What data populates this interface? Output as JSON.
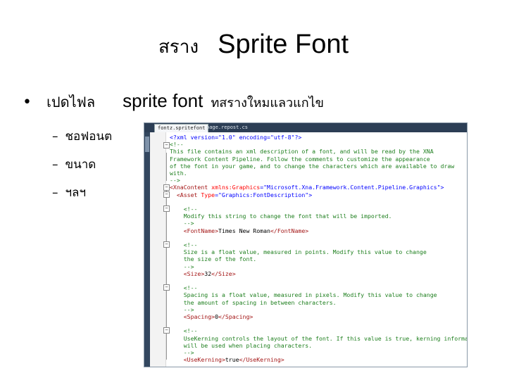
{
  "slide": {
    "title_thai": "สราง",
    "title_eng": "Sprite Font",
    "bullet": {
      "text1": "เปดไฟล",
      "text2": "sprite font",
      "text3": "ทสรางใหมแลวแกไข"
    },
    "subitems": [
      "ชอฟอนต",
      "ขนาด",
      "ฯลฯ"
    ],
    "dash": "–",
    "dot": "•"
  },
  "editor": {
    "tabs": [
      "fontz.spritefont",
      "page.repost.cs"
    ],
    "fold_minus": "−",
    "code": {
      "l1_pi": "<?xml version=\"1.0\" encoding=\"utf-8\"?>",
      "l2": "<!--",
      "l3": "This file contains an xml description of a font, and will be read by the XNA",
      "l4": "Framework Content Pipeline. Follow the comments to customize the appearance",
      "l5": "of the font in your game, and to change the characters which are available to draw",
      "l6": "with.",
      "l7": "-->",
      "l8_open": "<XnaContent",
      "l8_attr": " xmlns:Graphics",
      "l8_eq": "=",
      "l8_val": "\"Microsoft.Xna.Framework.Content.Pipeline.Graphics\"",
      "l8_close": ">",
      "l9_open": "<Asset",
      "l9_attr": " Type",
      "l9_eq": "=",
      "l9_val": "\"Graphics:FontDescription\"",
      "l9_close": ">",
      "c1_open": "<!--",
      "c1_text": "Modify this string to change the font that will be imported.",
      "c1_close": "-->",
      "fontname_open": "<FontName>",
      "fontname_val": "Times New Roman",
      "fontname_close": "</FontName>",
      "c2_open": "<!--",
      "c2_text1": "Size is a float value, measured in points. Modify this value to change",
      "c2_text2": "the size of the font.",
      "c2_close": "-->",
      "size_open": "<Size>",
      "size_val": "32",
      "size_close": "</Size>",
      "c3_open": "<!--",
      "c3_text1": "Spacing is a float value, measured in pixels. Modify this value to change",
      "c3_text2": "the amount of spacing in between characters.",
      "c3_close": "-->",
      "spacing_open": "<Spacing>",
      "spacing_val": "0",
      "spacing_close": "</Spacing>",
      "c4_open": "<!--",
      "c4_text1": "UseKerning controls the layout of the font. If this value is true, kerning informatio",
      "c4_text2": "will be used when placing characters.",
      "c4_close": "-->",
      "kern_open": "<UseKerning>",
      "kern_val": "true",
      "kern_close": "</UseKerning>"
    }
  },
  "colors": {
    "comment": "#1e7f1e",
    "tag": "#a31515",
    "attr": "#ff0000",
    "value": "#0000ff",
    "editor_frame": "#2c3e55"
  }
}
